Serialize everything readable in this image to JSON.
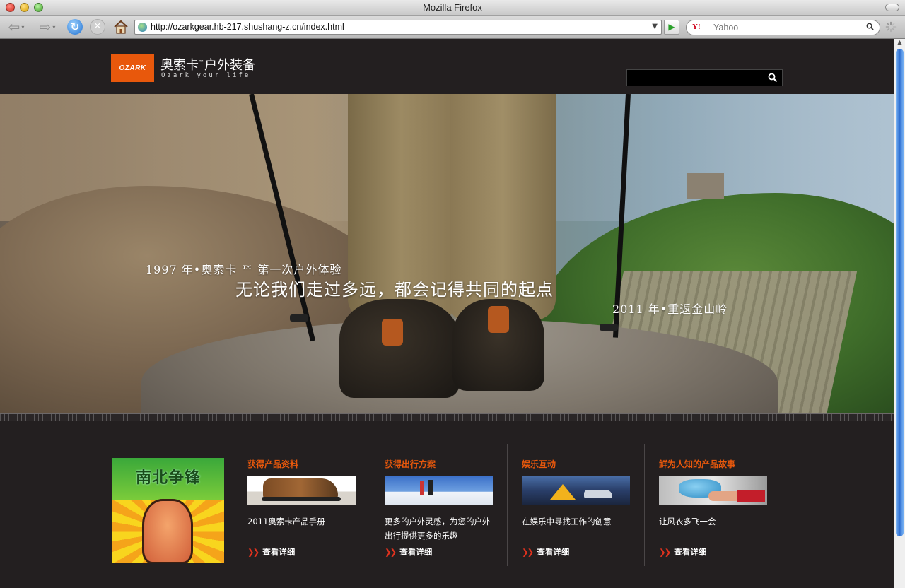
{
  "window": {
    "title": "Mozilla Firefox"
  },
  "toolbar": {
    "url": "http://ozarkgear.hb-217.shushang-z.cn/index.html",
    "search_placeholder": "Yahoo",
    "search_engine_icon": "Y!"
  },
  "site": {
    "logo_text": "OZARK",
    "brand": "奥索卡",
    "brand_tm": "™",
    "brand_suffix": "户外装备",
    "tagline": "Ozark your life"
  },
  "hero": {
    "line1": "1997 年•奥索卡 ™ 第一次户外体验",
    "line2": "无论我们走过多远，都会记得共同的起点",
    "line3": "2011 年•重返金山岭"
  },
  "promo": {
    "title": "南北争锋"
  },
  "columns": [
    {
      "title": "获得产品资料",
      "desc": "2011奥索卡产品手册",
      "more": "查看详细"
    },
    {
      "title": "获得出行方案",
      "desc": "更多的户外灵感，为您的户外出行提供更多的乐趣",
      "more": "查看详细"
    },
    {
      "title": "娱乐互动",
      "desc": "在娱乐中寻找工作的创意",
      "more": "查看详细"
    },
    {
      "title": "鲜为人知的产品故事",
      "desc": "让风衣多飞一会",
      "more": "查看详细"
    }
  ],
  "colors": {
    "accent": "#e8580c",
    "background": "#231f20",
    "chevron": "#e0321e"
  }
}
